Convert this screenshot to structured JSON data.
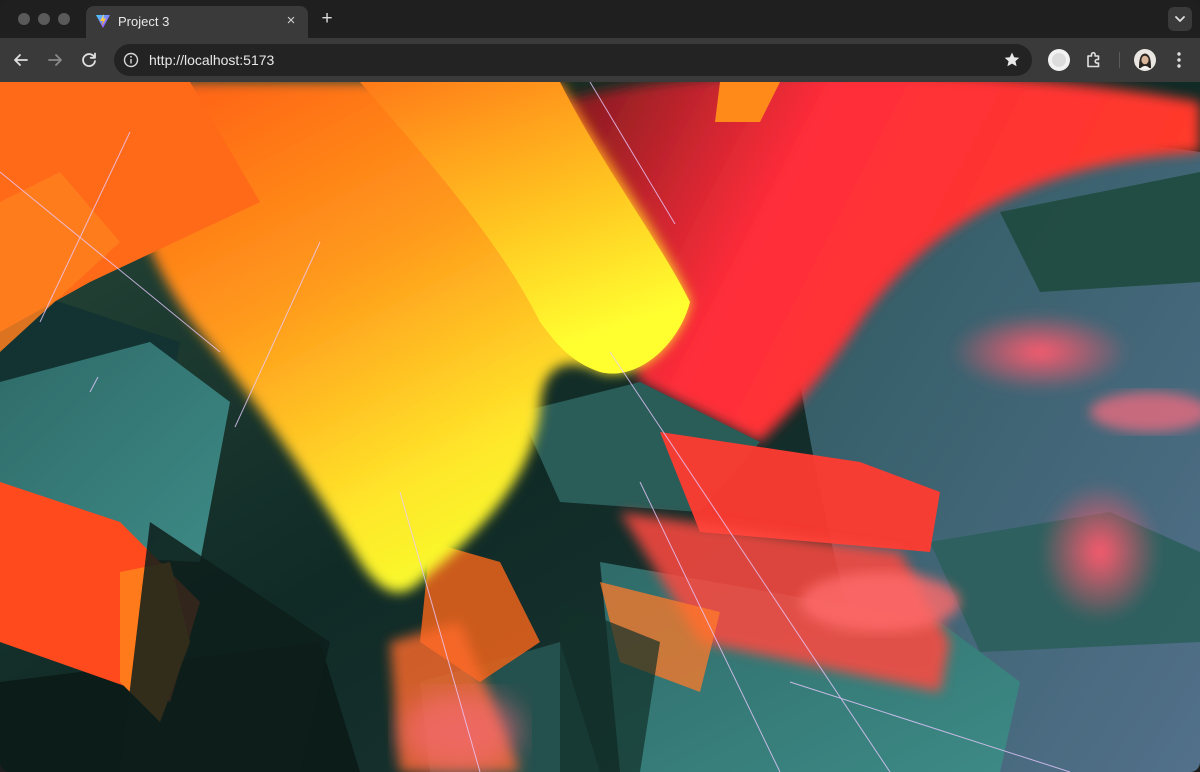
{
  "browser": {
    "tab": {
      "title": "Project 3",
      "close_glyph": "×"
    },
    "new_tab_glyph": "+",
    "address": {
      "url": "http://localhost:5173"
    }
  },
  "icons": [
    "vite-favicon",
    "back-icon",
    "forward-icon",
    "reload-icon",
    "info-icon",
    "star-icon",
    "profile-circle-icon",
    "extensions-icon",
    "avatar",
    "more-menu-icon",
    "tab-search-icon"
  ],
  "colors": {
    "tab_bg": "#3a3a3a",
    "toolbar_bg": "#3a3a3a",
    "omnibox_bg": "#232323",
    "canvas_bg": "#0d1f1c"
  }
}
